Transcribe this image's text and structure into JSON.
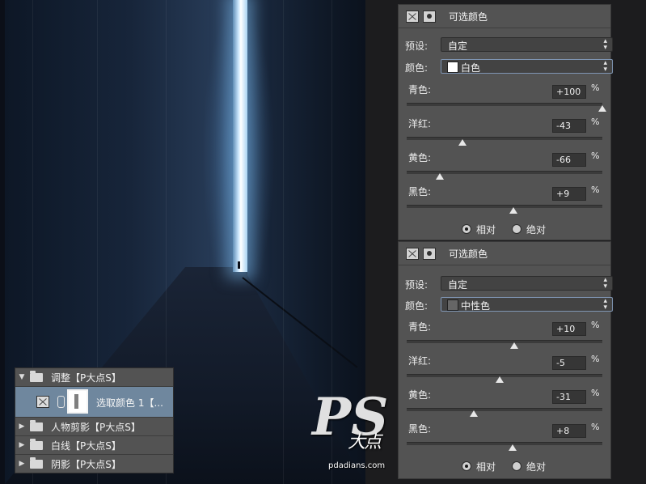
{
  "canvas": {
    "label": "photo-canvas"
  },
  "layers": {
    "group_adjust": "调整【P大点S】",
    "selected_layer": "选取颜色 1【...",
    "group_cutout": "人物剪影【P大点S】",
    "group_whiteline": "白线【P大点S】",
    "group_shadow": "阴影【P大点S】"
  },
  "panel1": {
    "title": "可选颜色",
    "preset_label": "预设:",
    "preset_value": "自定",
    "color_label": "颜色:",
    "color_value": "白色",
    "swatch_color": "#ffffff",
    "sliders": [
      {
        "label": "青色:",
        "value": "+100",
        "unit": "%",
        "num": 100
      },
      {
        "label": "洋红:",
        "value": "-43",
        "unit": "%",
        "num": -43
      },
      {
        "label": "黄色:",
        "value": "-66",
        "unit": "%",
        "num": -66
      },
      {
        "label": "黑色:",
        "value": "+9",
        "unit": "%",
        "num": 9
      }
    ],
    "radio_relative": "相对",
    "radio_absolute": "绝对",
    "mode": "relative"
  },
  "panel2": {
    "title": "可选颜色",
    "preset_label": "预设:",
    "preset_value": "自定",
    "color_label": "颜色:",
    "color_value": "中性色",
    "swatch_color": "#666666",
    "sliders": [
      {
        "label": "青色:",
        "value": "+10",
        "unit": "%",
        "num": 10
      },
      {
        "label": "洋红:",
        "value": "-5",
        "unit": "%",
        "num": -5
      },
      {
        "label": "黄色:",
        "value": "-31",
        "unit": "%",
        "num": -31
      },
      {
        "label": "黑色:",
        "value": "+8",
        "unit": "%",
        "num": 8
      }
    ],
    "radio_relative": "相对",
    "radio_absolute": "绝对",
    "mode": "relative"
  },
  "watermark": {
    "big": "PS",
    "mid": "大点",
    "url": "pdadians.com"
  }
}
